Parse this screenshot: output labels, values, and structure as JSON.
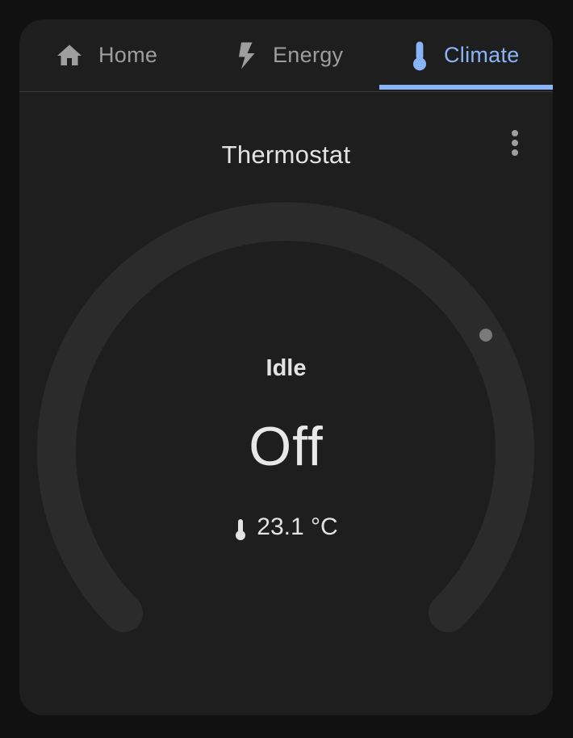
{
  "tabs": [
    {
      "label": "Home",
      "icon": "home-icon",
      "active": false
    },
    {
      "label": "Energy",
      "icon": "lightning-bolt-icon",
      "active": false
    },
    {
      "label": "Climate",
      "icon": "thermometer-icon",
      "active": true
    }
  ],
  "card": {
    "title": "Thermostat",
    "menu_icon": "more-vertical-icon"
  },
  "thermostat": {
    "status": "Idle",
    "mode": "Off",
    "current_temperature": "23.1 °C"
  },
  "colors": {
    "accent": "#8ab4f8",
    "background": "#111111",
    "card": "#1e1e1e",
    "dial_track": "#2b2b2b",
    "text": "#e3e3e3",
    "muted": "#9e9e9e"
  }
}
